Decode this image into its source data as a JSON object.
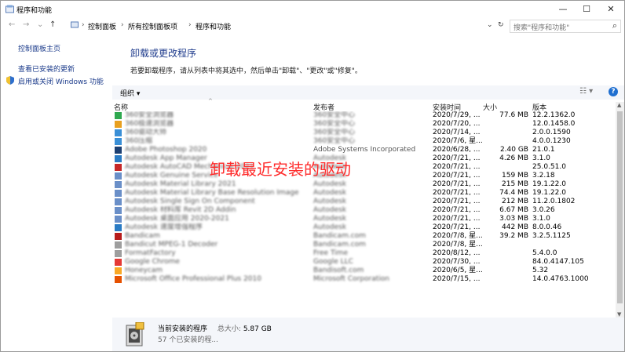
{
  "window": {
    "title": "程序和功能",
    "minimize": "—",
    "maximize": "☐",
    "close": "✕"
  },
  "nav": {
    "back": "←",
    "forward": "→",
    "dropdown": "⌄",
    "up": "↑",
    "breadcrumbs": [
      "控制面板",
      "所有控制面板项",
      "程序和功能"
    ],
    "sep": "›",
    "addr_dropdown": "⌄",
    "refresh": "↻",
    "search_placeholder": "搜索\"程序和功能\""
  },
  "sidebar": {
    "links": [
      "控制面板主页",
      "查看已安装的更新",
      "启用或关闭 Windows 功能"
    ]
  },
  "main": {
    "heading": "卸载或更改程序",
    "subtext": "若要卸载程序，请从列表中将其选中，然后单击\"卸载\"、\"更改\"或\"修复\"。",
    "organize": "组织 ▾",
    "view_icon": "☷ ▾",
    "help": "?",
    "columns": {
      "name": "名称",
      "publisher": "发布者",
      "installed_on": "安装时间",
      "size": "大小",
      "version": "版本"
    },
    "overlay_text": "卸载最近安装的驱动"
  },
  "programs": [
    {
      "name": "360安全浏览器",
      "publisher": "360安全中心",
      "date": "2020/7/29, ...",
      "size": "77.6 MB",
      "version": "12.2.1362.0",
      "color": "#2fa84f"
    },
    {
      "name": "360极速浏览器",
      "publisher": "360安全中心",
      "date": "2020/7/20, ...",
      "size": "",
      "version": "12.0.1458.0",
      "color": "#e8a020"
    },
    {
      "name": "360驱动大师",
      "publisher": "360安全中心",
      "date": "2020/7/14, ...",
      "size": "",
      "version": "2.0.0.1590",
      "color": "#3a8fd6"
    },
    {
      "name": "360压缩",
      "publisher": "360安全中心",
      "date": "2020/7/6, 星...",
      "size": "",
      "version": "4.0.0.1230",
      "color": "#3a8fd6"
    },
    {
      "name": "Adobe Photoshop 2020",
      "publisher": "Adobe Systems Incorporated",
      "date": "2020/6/28, ...",
      "size": "2.40 GB",
      "version": "21.0.1",
      "color": "#1c3f72"
    },
    {
      "name": "Autodesk App Manager",
      "publisher": "Autodesk",
      "date": "2020/7/21, ...",
      "size": "4.26 MB",
      "version": "3.1.0",
      "color": "#2a7bc4"
    },
    {
      "name": "Autodesk AutoCAD Mechanical 2021",
      "publisher": "Autodesk",
      "date": "2020/7/21, ...",
      "size": "",
      "version": "25.0.51.0",
      "color": "#c62828"
    },
    {
      "name": "Autodesk Genuine Service",
      "publisher": "Autodesk",
      "date": "2020/7/21, ...",
      "size": "159 MB",
      "version": "3.2.18",
      "color": "#6a8fc8"
    },
    {
      "name": "Autodesk Material Library 2021",
      "publisher": "Autodesk",
      "date": "2020/7/21, ...",
      "size": "215 MB",
      "version": "19.1.22.0",
      "color": "#6a8fc8"
    },
    {
      "name": "Autodesk Material Library Base Resolution Image Library ...",
      "publisher": "Autodesk",
      "date": "2020/7/21, ...",
      "size": "74.4 MB",
      "version": "19.1.22.0",
      "color": "#6a8fc8"
    },
    {
      "name": "Autodesk Single Sign On Component",
      "publisher": "Autodesk",
      "date": "2020/7/21, ...",
      "size": "212 MB",
      "version": "11.2.0.1802",
      "color": "#6a8fc8"
    },
    {
      "name": "Autodesk 材料库 Revit 2D Addin",
      "publisher": "Autodesk",
      "date": "2020/7/21, ...",
      "size": "6.67 MB",
      "version": "3.0.26",
      "color": "#6a8fc8"
    },
    {
      "name": "Autodesk 桌面应用 2020-2021",
      "publisher": "Autodesk",
      "date": "2020/7/21, ...",
      "size": "3.03 MB",
      "version": "3.1.0",
      "color": "#6a8fc8"
    },
    {
      "name": "Autodesk 速度增强程序",
      "publisher": "Autodesk",
      "date": "2020/7/21, ...",
      "size": "442 MB",
      "version": "8.0.0.46",
      "color": "#2a7bc4"
    },
    {
      "name": "Bandicam",
      "publisher": "Bandicam.com",
      "date": "2020/7/8, 星...",
      "size": "39.2 MB",
      "version": "3.2.5.1125",
      "color": "#b71c1c"
    },
    {
      "name": "Bandicut MPEG-1 Decoder",
      "publisher": "Bandicam.com",
      "date": "2020/7/8, 星...",
      "size": "",
      "version": "",
      "color": "#9e9e9e"
    },
    {
      "name": "FormatFactory",
      "publisher": "Free Time",
      "date": "2020/8/12, ...",
      "size": "",
      "version": "5.4.0.0",
      "color": "#9e9e9e"
    },
    {
      "name": "Google Chrome",
      "publisher": "Google LLC",
      "date": "2020/7/30, ...",
      "size": "",
      "version": "84.0.4147.105",
      "color": "#e53935"
    },
    {
      "name": "Honeycam",
      "publisher": "Bandisoft.com",
      "date": "2020/6/5, 星...",
      "size": "",
      "version": "5.32",
      "color": "#f9a825"
    },
    {
      "name": "Microsoft Office Professional Plus 2010",
      "publisher": "Microsoft Corporation",
      "date": "2020/7/15, ...",
      "size": "",
      "version": "14.0.4763.1000",
      "color": "#e65100"
    }
  ],
  "status": {
    "title": "当前安装的程序",
    "total_label": "总大小:",
    "total_value": "5.87 GB",
    "count": "57 个已安装的程..."
  }
}
